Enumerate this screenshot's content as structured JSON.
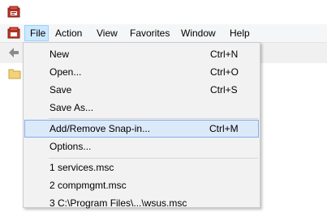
{
  "menubar": {
    "items": [
      {
        "label": "File"
      },
      {
        "label": "Action"
      },
      {
        "label": "View"
      },
      {
        "label": "Favorites"
      },
      {
        "label": "Window"
      },
      {
        "label": "Help"
      }
    ]
  },
  "file_menu": {
    "items": [
      {
        "label": "New",
        "shortcut": "Ctrl+N"
      },
      {
        "label": "Open...",
        "shortcut": "Ctrl+O"
      },
      {
        "label": "Save",
        "shortcut": "Ctrl+S"
      },
      {
        "label": "Save As..."
      },
      {
        "label": "Add/Remove Snap-in...",
        "shortcut": "Ctrl+M"
      },
      {
        "label": "Options..."
      },
      {
        "label": "1 services.msc"
      },
      {
        "label": "2 compmgmt.msc"
      },
      {
        "label": "3 C:\\Program Files\\...\\wsus.msc"
      }
    ],
    "highlighted_index": 4
  },
  "colors": {
    "menu_hover_bg": "#dbe9f9",
    "menu_hover_border": "#84aee6",
    "menubar_active_bg": "#cce8ff"
  }
}
